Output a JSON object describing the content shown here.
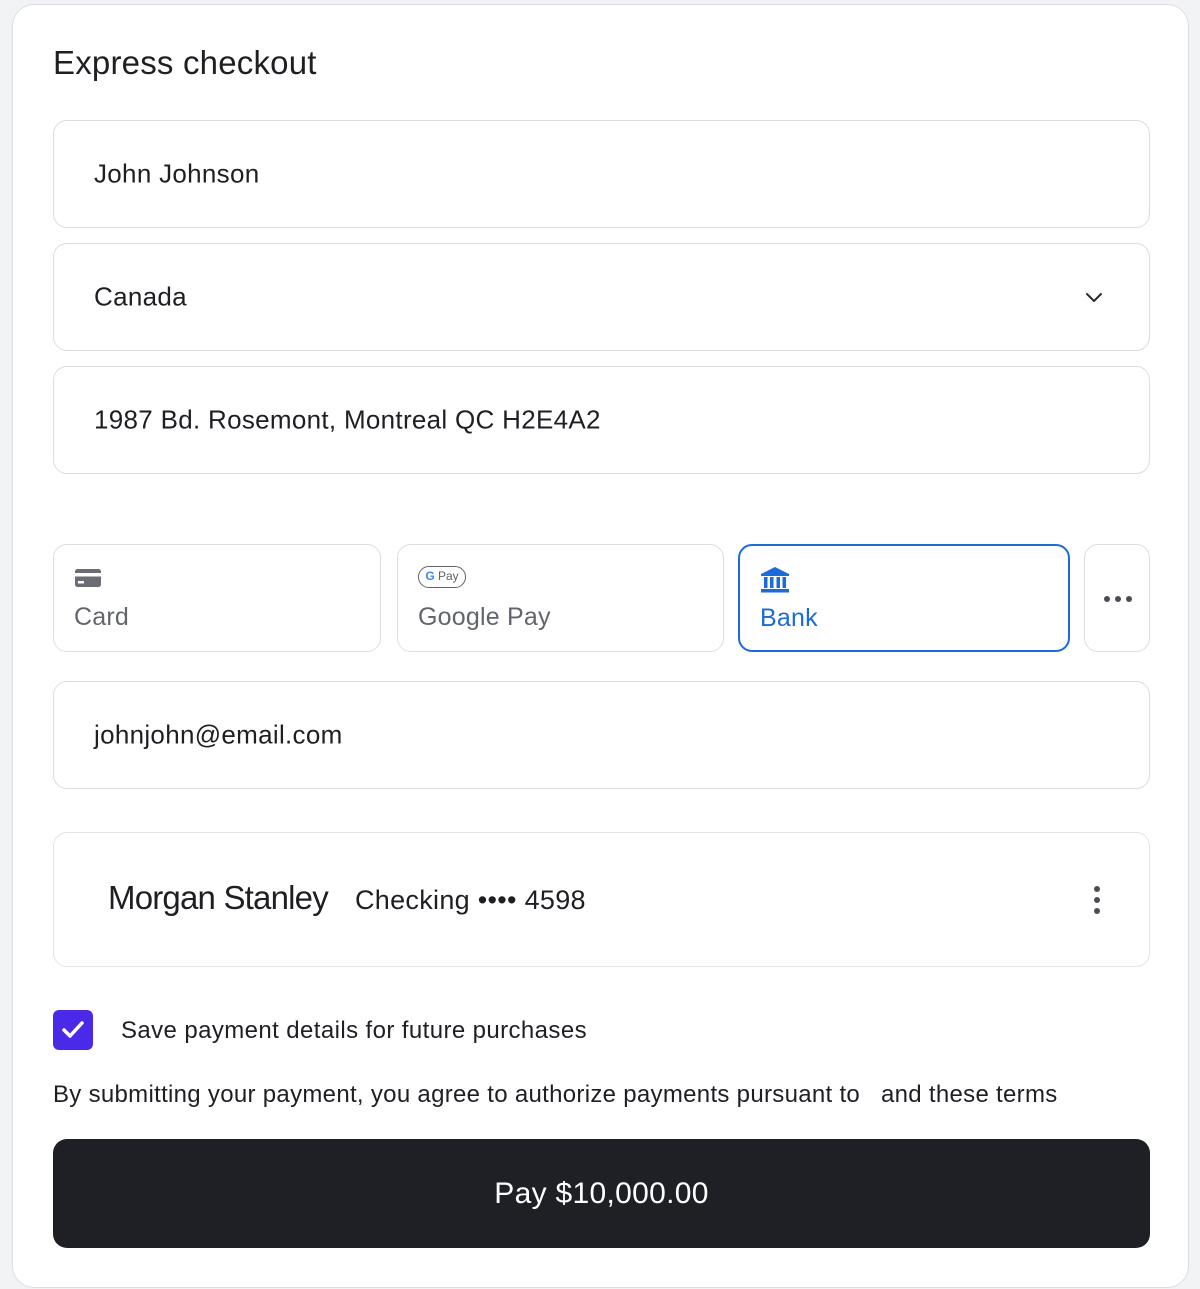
{
  "checkout": {
    "title": "Express checkout",
    "name_value": "John Johnson",
    "country_value": "Canada",
    "address_value": "1987 Bd. Rosemont, Montreal QC H2E4A2",
    "email_value": "johnjohn@email.com"
  },
  "payment_methods": {
    "tabs": [
      {
        "label": "Card",
        "icon": "credit-card-icon",
        "selected": false
      },
      {
        "label": "Google Pay",
        "icon": "google-pay-icon",
        "badge_text": "G Pay",
        "selected": false
      },
      {
        "label": "Bank",
        "icon": "bank-icon",
        "selected": true
      }
    ],
    "more_icon": "more-horizontal-icon"
  },
  "bank_account": {
    "bank_name": "Morgan Stanley",
    "account_label": "Checking •••• 4598",
    "menu_icon": "more-vertical-icon"
  },
  "save_details": {
    "label": "Save payment details for future purchases",
    "checked": true
  },
  "terms_text": "By submitting your payment, you agree to authorize payments pursuant to   and these terms",
  "pay_button_label": "Pay $10,000.00",
  "colors": {
    "accent_blue": "#1b6bd8",
    "checkbox_purple": "#4a2ae8",
    "button_dark": "#1e2025"
  }
}
